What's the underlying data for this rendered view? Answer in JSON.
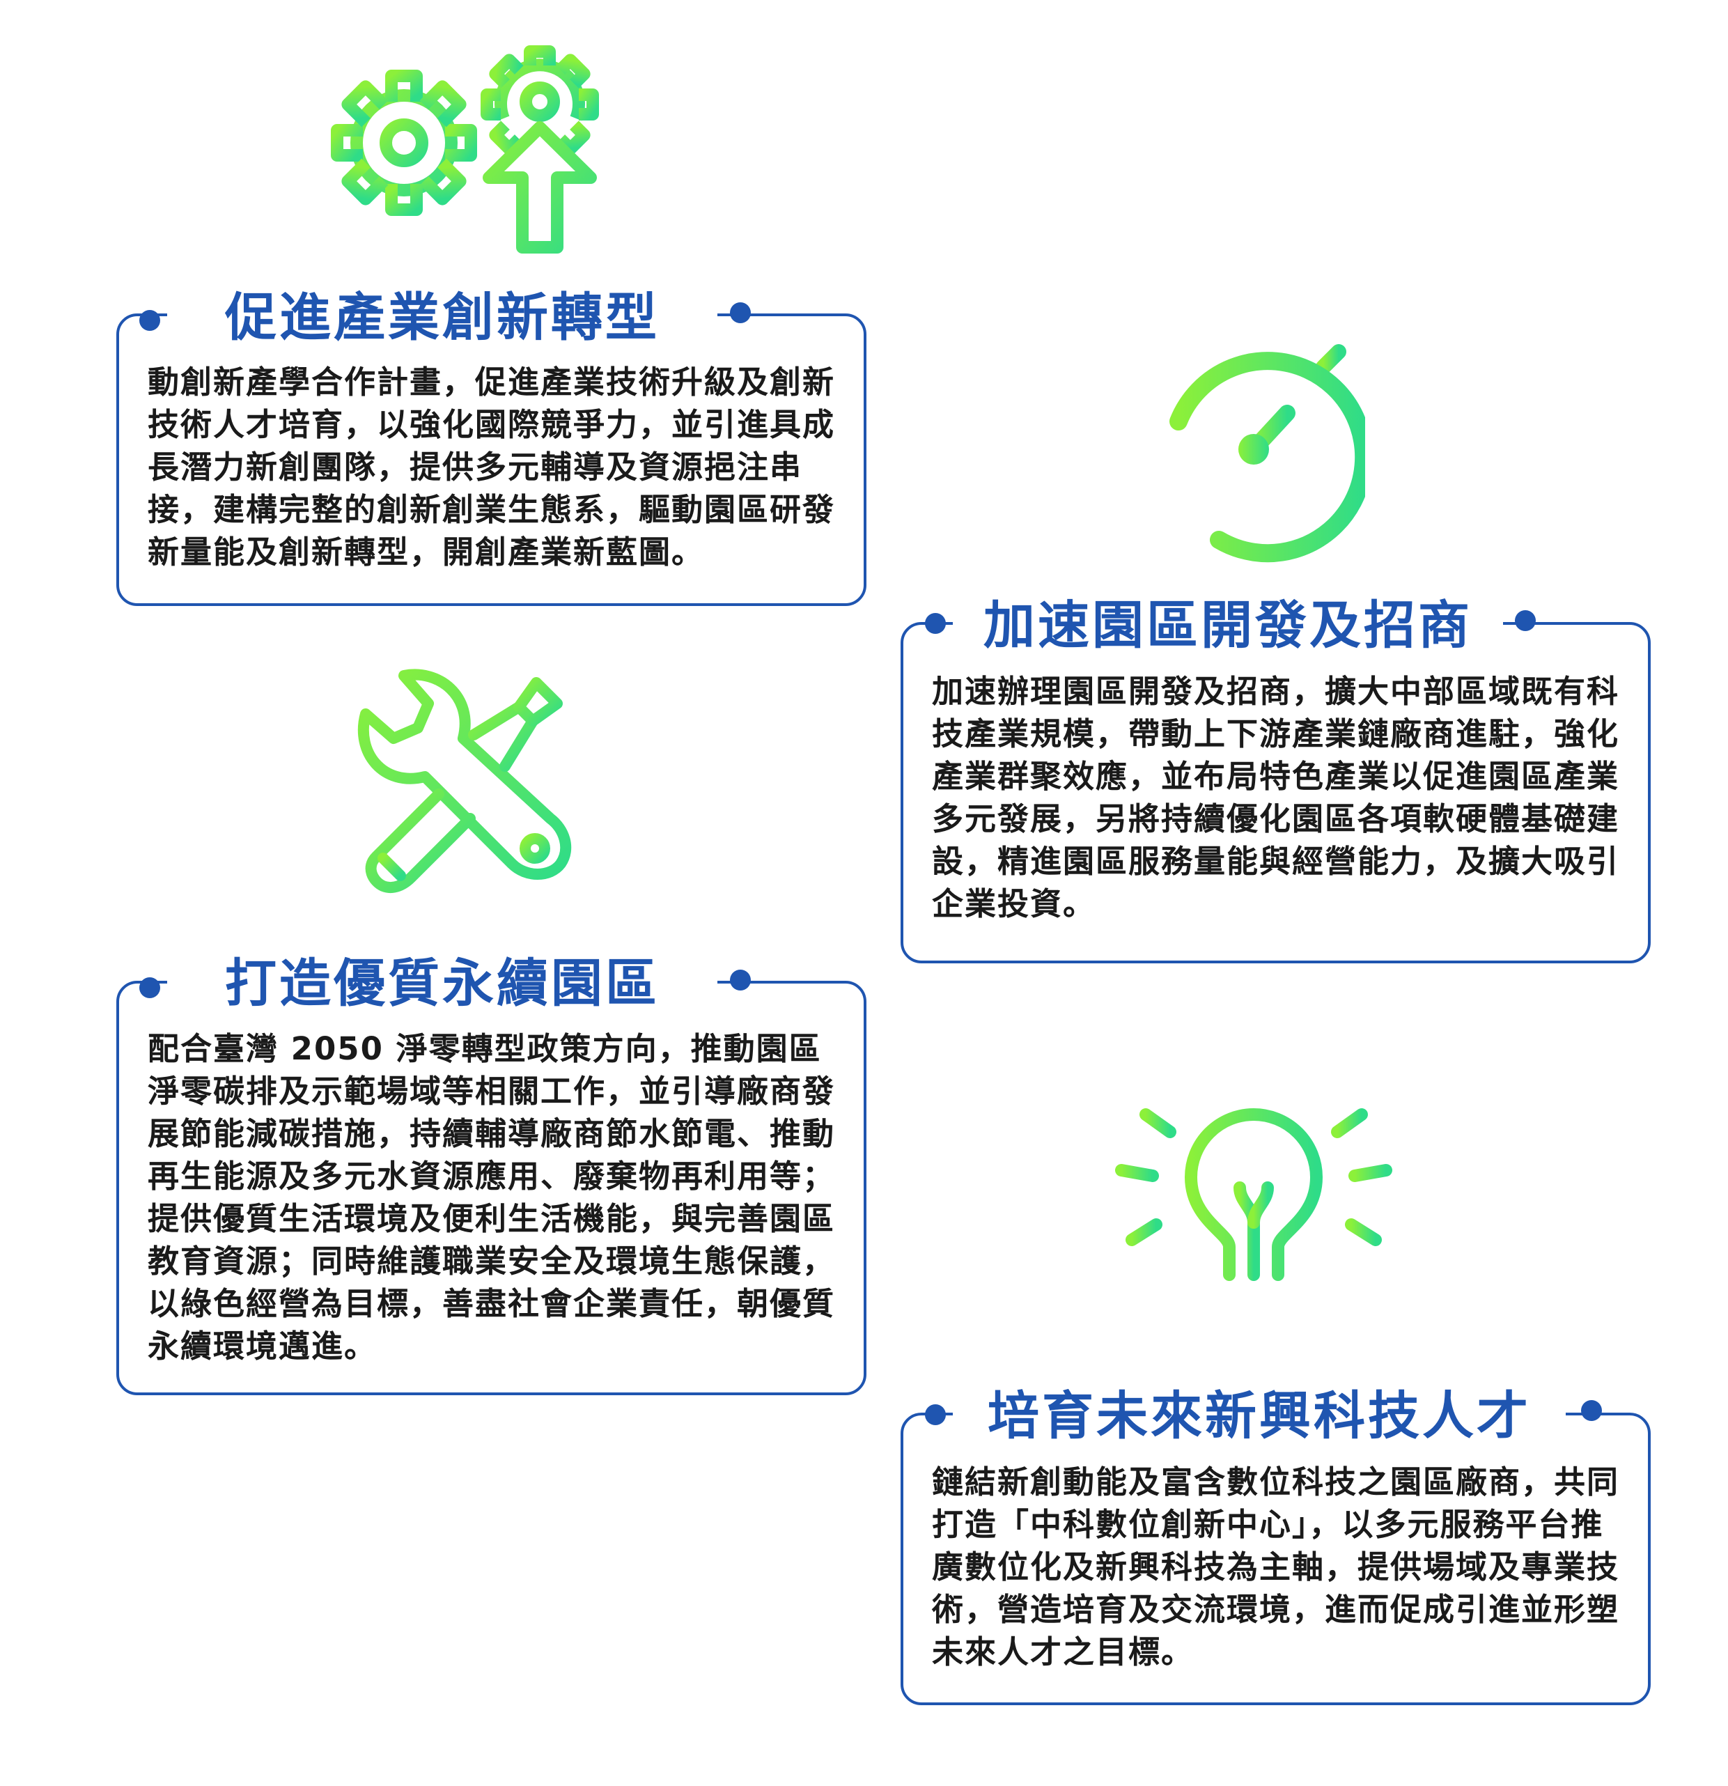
{
  "colors": {
    "card_border": "#1f55b0",
    "title_text": "#1f55b0",
    "body_text": "#1a1a1a",
    "icon_gradient_start": "#8cf03a",
    "icon_gradient_end": "#2fdc88"
  },
  "sections": [
    {
      "icon": "gears-arrow-up-icon",
      "title": "促進產業創新轉型",
      "body": "動創新產學合作計畫，促進產業技術升級及創新技術人才培育，以強化國際競爭力，並引進具成長潛力新創團隊，提供多元輔導及資源挹注串接，建構完整的創新創業生態系，驅動園區研發新量能及創新轉型，開創產業新藍圖。"
    },
    {
      "icon": "stopwatch-speed-icon",
      "title": "加速園區開發及招商",
      "body": "加速辦理園區開發及招商，擴大中部區域既有科技產業規模，帶動上下游產業鏈廠商進駐，強化產業群聚效應，並布局特色產業以促進園區產業多元發展，另將持續優化園區各項軟硬體基礎建設，精進園區服務量能與經營能力，及擴大吸引企業投資。"
    },
    {
      "icon": "wrench-screwdriver-icon",
      "title": "打造優質永續園區",
      "body": "配合臺灣 2050 淨零轉型政策方向，推動園區淨零碳排及示範場域等相關工作，並引導廠商發展節能減碳措施，持續輔導廠商節水節電、推動再生能源及多元水資源應用、廢棄物再利用等；提供優質生活環境及便利生活機能，與完善園區教育資源；同時維護職業安全及環境生態保護，以綠色經營為目標，善盡社會企業責任，朝優質永續環境邁進。"
    },
    {
      "icon": "lightbulb-icon",
      "title": "培育未來新興科技人才",
      "body": "鏈結新創動能及富含數位科技之園區廠商，共同打造「中科數位創新中心」，以多元服務平台推廣數位化及新興科技為主軸，提供場域及專業技術，營造培育及交流環境，進而促成引進並形塑未來人才之目標。"
    }
  ]
}
